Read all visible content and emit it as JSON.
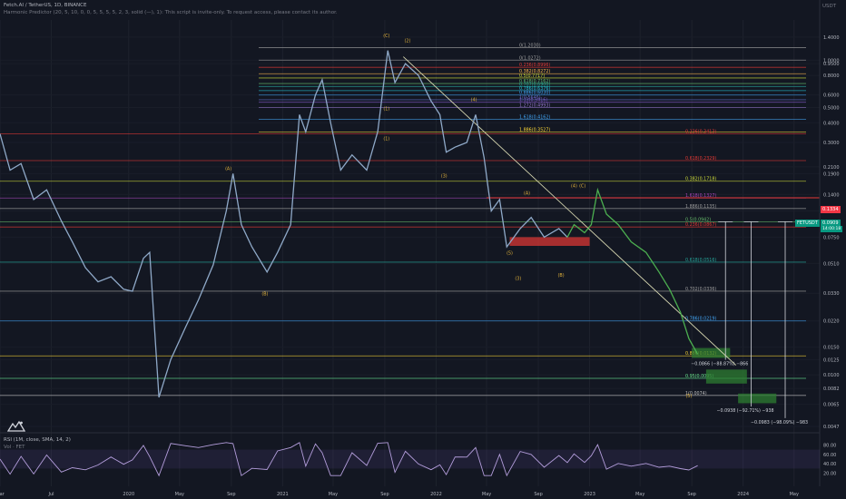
{
  "header": {
    "symbol_line": "Fetch.AI / TetherUS, 1D, BINANCE",
    "indicator_line": "Harmonic Predictor (20, 5, 10, 0, 0, 5, 5, 5, 5, 2, 3, solid (—), 1): This script is invite-only. To request access, please contact its author."
  },
  "currency": "USDT",
  "price_badges": {
    "red": "0.1334",
    "teal_price": "0.0909",
    "teal_time": "14:00:18",
    "teal_label": "FETUSDT"
  },
  "rsi_header": "RSI (1M, close, SMA, 14, 2)",
  "vol_header": "Vol · FET",
  "colors": {
    "background": "#131722",
    "price_line": "#8fa9c8",
    "price_line_recent": "#4caf50",
    "red_zone": "#e53935",
    "green_zone": "#2e7d32",
    "rsi_line": "#b39ddb",
    "trendline": "#d6d6b0"
  },
  "chart_data": {
    "type": "line",
    "title": "Fetch.AI / TetherUS, 1D, BINANCE",
    "y_scale": "log",
    "ylim": [
      0.0047,
      1.8
    ],
    "xlim": [
      "2019-03-01",
      "2024-07-01"
    ],
    "x_ticks": [
      {
        "date": "2019-03-01",
        "label": "Mar"
      },
      {
        "date": "2019-07-01",
        "label": "Jul"
      },
      {
        "date": "2020-01-01",
        "label": "2020"
      },
      {
        "date": "2020-05-01",
        "label": "May"
      },
      {
        "date": "2020-09-01",
        "label": "Sep"
      },
      {
        "date": "2021-01-01",
        "label": "2021"
      },
      {
        "date": "2021-05-01",
        "label": "May"
      },
      {
        "date": "2021-09-01",
        "label": "Sep"
      },
      {
        "date": "2022-01-01",
        "label": "2022"
      },
      {
        "date": "2022-05-01",
        "label": "May"
      },
      {
        "date": "2022-09-01",
        "label": "Sep"
      },
      {
        "date": "2023-01-01",
        "label": "2023"
      },
      {
        "date": "2023-05-01",
        "label": "May"
      },
      {
        "date": "2023-09-01",
        "label": "Sep"
      },
      {
        "date": "2024-01-01",
        "label": "2024"
      },
      {
        "date": "2024-05-01",
        "label": "May"
      }
    ],
    "y_ticks": [
      1.4,
      1.0,
      0.95,
      0.8,
      0.6,
      0.5,
      0.4,
      0.3,
      0.21,
      0.19,
      0.14,
      0.11,
      0.075,
      0.051,
      0.033,
      0.022,
      0.015,
      0.0125,
      0.01,
      0.0082,
      0.0065,
      0.0047
    ],
    "series": [
      {
        "points": [
          [
            "2019-03-01",
            0.34
          ],
          [
            "2019-03-25",
            0.2
          ],
          [
            "2019-04-20",
            0.22
          ],
          [
            "2019-05-20",
            0.13
          ],
          [
            "2019-06-20",
            0.15
          ],
          [
            "2019-07-25",
            0.095
          ],
          [
            "2019-08-20",
            0.07
          ],
          [
            "2019-09-20",
            0.048
          ],
          [
            "2019-10-20",
            0.039
          ],
          [
            "2019-11-20",
            0.042
          ],
          [
            "2019-12-20",
            0.035
          ],
          [
            "2020-01-10",
            0.034
          ],
          [
            "2020-02-05",
            0.055
          ],
          [
            "2020-02-20",
            0.06
          ],
          [
            "2020-03-13",
            0.0072
          ],
          [
            "2020-04-10",
            0.0125
          ],
          [
            "2020-05-15",
            0.02
          ],
          [
            "2020-06-15",
            0.03
          ],
          [
            "2020-07-20",
            0.05
          ],
          [
            "2020-08-20",
            0.11
          ],
          [
            "2020-09-05",
            0.19
          ],
          [
            "2020-09-25",
            0.09
          ],
          [
            "2020-10-20",
            0.065
          ],
          [
            "2020-11-25",
            0.045
          ],
          [
            "2020-12-20",
            0.06
          ],
          [
            "2021-01-20",
            0.09
          ],
          [
            "2021-02-10",
            0.45
          ],
          [
            "2021-02-25",
            0.35
          ],
          [
            "2021-03-20",
            0.6
          ],
          [
            "2021-04-05",
            0.75
          ],
          [
            "2021-04-25",
            0.4
          ],
          [
            "2021-05-19",
            0.2
          ],
          [
            "2021-06-15",
            0.25
          ],
          [
            "2021-07-20",
            0.2
          ],
          [
            "2021-08-15",
            0.35
          ],
          [
            "2021-09-08",
            1.15
          ],
          [
            "2021-09-25",
            0.72
          ],
          [
            "2021-10-20",
            0.95
          ],
          [
            "2021-11-20",
            0.8
          ],
          [
            "2021-12-20",
            0.55
          ],
          [
            "2022-01-10",
            0.45
          ],
          [
            "2022-01-25",
            0.26
          ],
          [
            "2022-02-15",
            0.28
          ],
          [
            "2022-03-15",
            0.3
          ],
          [
            "2022-04-05",
            0.45
          ],
          [
            "2022-04-25",
            0.24
          ],
          [
            "2022-05-12",
            0.11
          ],
          [
            "2022-06-01",
            0.13
          ],
          [
            "2022-06-18",
            0.065
          ],
          [
            "2022-07-20",
            0.085
          ],
          [
            "2022-08-15",
            0.1
          ],
          [
            "2022-09-15",
            0.075
          ],
          [
            "2022-10-20",
            0.085
          ],
          [
            "2022-11-09",
            0.075
          ]
        ]
      },
      {
        "points": [
          [
            "2022-11-09",
            0.075
          ],
          [
            "2022-11-25",
            0.09
          ],
          [
            "2022-12-20",
            0.08
          ],
          [
            "2023-01-05",
            0.09
          ],
          [
            "2023-01-20",
            0.15
          ],
          [
            "2023-02-10",
            0.105
          ],
          [
            "2023-03-10",
            0.09
          ],
          [
            "2023-04-10",
            0.07
          ],
          [
            "2023-05-15",
            0.06
          ],
          [
            "2023-06-15",
            0.045
          ],
          [
            "2023-07-10",
            0.035
          ],
          [
            "2023-08-05",
            0.025
          ],
          [
            "2023-08-25",
            0.017
          ],
          [
            "2023-09-15",
            0.0135
          ]
        ]
      }
    ],
    "fib_levels": [
      {
        "label": "0(1.2030)",
        "value": 1.2
      },
      {
        "label": "0(1.0272)",
        "value": 1.0
      },
      {
        "label": "0.236(0.8996)",
        "value": 0.9
      },
      {
        "label": "0.382(0.8272)",
        "value": 0.82
      },
      {
        "label": "0.5(0.7717)",
        "value": 0.77
      },
      {
        "label": "0.618(0.7162)",
        "value": 0.71
      },
      {
        "label": "0.707(0.6900)",
        "value": 0.68
      },
      {
        "label": "0.786(0.6376)",
        "value": 0.64
      },
      {
        "label": "0.886(0.6030)",
        "value": 0.6
      },
      {
        "label": "1(0.5645)",
        "value": 0.56
      },
      {
        "label": "1.13(0.5416)",
        "value": 0.54
      },
      {
        "label": "1.272(0.4993)",
        "value": 0.5
      },
      {
        "label": "1.618(0.4162)",
        "value": 0.42
      },
      {
        "label": "1.886(0.3527)",
        "value": 0.35
      },
      {
        "label": "0.236(0.3413)",
        "value": 0.34
      },
      {
        "label": "0.618(0.2329)",
        "value": 0.23
      },
      {
        "label": "0.382(0.1718)",
        "value": 0.17
      },
      {
        "label": "1.618(0.1327)",
        "value": 0.133
      },
      {
        "label": "1.886(0.1135)",
        "value": 0.114
      },
      {
        "label": "0.236(0.0867)",
        "value": 0.087
      },
      {
        "label": "0.5(0.0942)",
        "value": 0.094
      },
      {
        "label": "0.618(0.0516)",
        "value": 0.052
      },
      {
        "label": "0.702(0.0336)",
        "value": 0.034
      },
      {
        "label": "0.786(0.0219)",
        "value": 0.022
      },
      {
        "label": "0.886(0.0132)",
        "value": 0.0132
      },
      {
        "label": "0.95(0.0095)",
        "value": 0.0095
      },
      {
        "label": "0.95(0.0095)",
        "value": 0.0095
      },
      {
        "label": "1(0.0074)",
        "value": 0.0074
      }
    ],
    "wave_labels": [
      {
        "text": "(C)",
        "date": "2021-09-05",
        "value": 1.4
      },
      {
        "text": "(2)",
        "date": "2021-10-25",
        "value": 1.3
      },
      {
        "text": "(A)",
        "date": "2020-08-25",
        "value": 0.2
      },
      {
        "text": "(B)",
        "date": "2020-11-20",
        "value": 0.032
      },
      {
        "text": "(1)",
        "date": "2021-09-05",
        "value": 0.48
      },
      {
        "text": "(1)",
        "date": "2021-09-05",
        "value": 0.31
      },
      {
        "text": "(3)",
        "date": "2022-01-20",
        "value": 0.18
      },
      {
        "text": "(4)",
        "date": "2022-04-01",
        "value": 0.55
      },
      {
        "text": "(A)",
        "date": "2022-08-05",
        "value": 0.14
      },
      {
        "text": "(5)",
        "date": "2022-06-25",
        "value": 0.058
      },
      {
        "text": "(3)",
        "date": "2022-07-15",
        "value": 0.04
      },
      {
        "text": "(B)",
        "date": "2022-10-25",
        "value": 0.042
      },
      {
        "text": "(4)",
        "date": "2022-11-25",
        "value": 0.155
      },
      {
        "text": "(C)",
        "date": "2022-12-15",
        "value": 0.155
      },
      {
        "text": "(5)",
        "date": "2023-08-25",
        "value": 0.0072
      }
    ],
    "target_annotations": [
      {
        "text": "−0.0866 (−88.87%) −866",
        "date": "2023-11-20",
        "value": 0.0115
      },
      {
        "text": "−0.0938 (−92.71%) −938",
        "date": "2024-01-20",
        "value": 0.0058
      },
      {
        "text": "−0.0983 (−98.09%) −983",
        "date": "2024-04-10",
        "value": 0.0049
      }
    ],
    "rsi": {
      "ylim": [
        0,
        100
      ],
      "y_ticks": [
        80,
        60,
        40,
        20
      ],
      "band": [
        30,
        70
      ]
    }
  }
}
